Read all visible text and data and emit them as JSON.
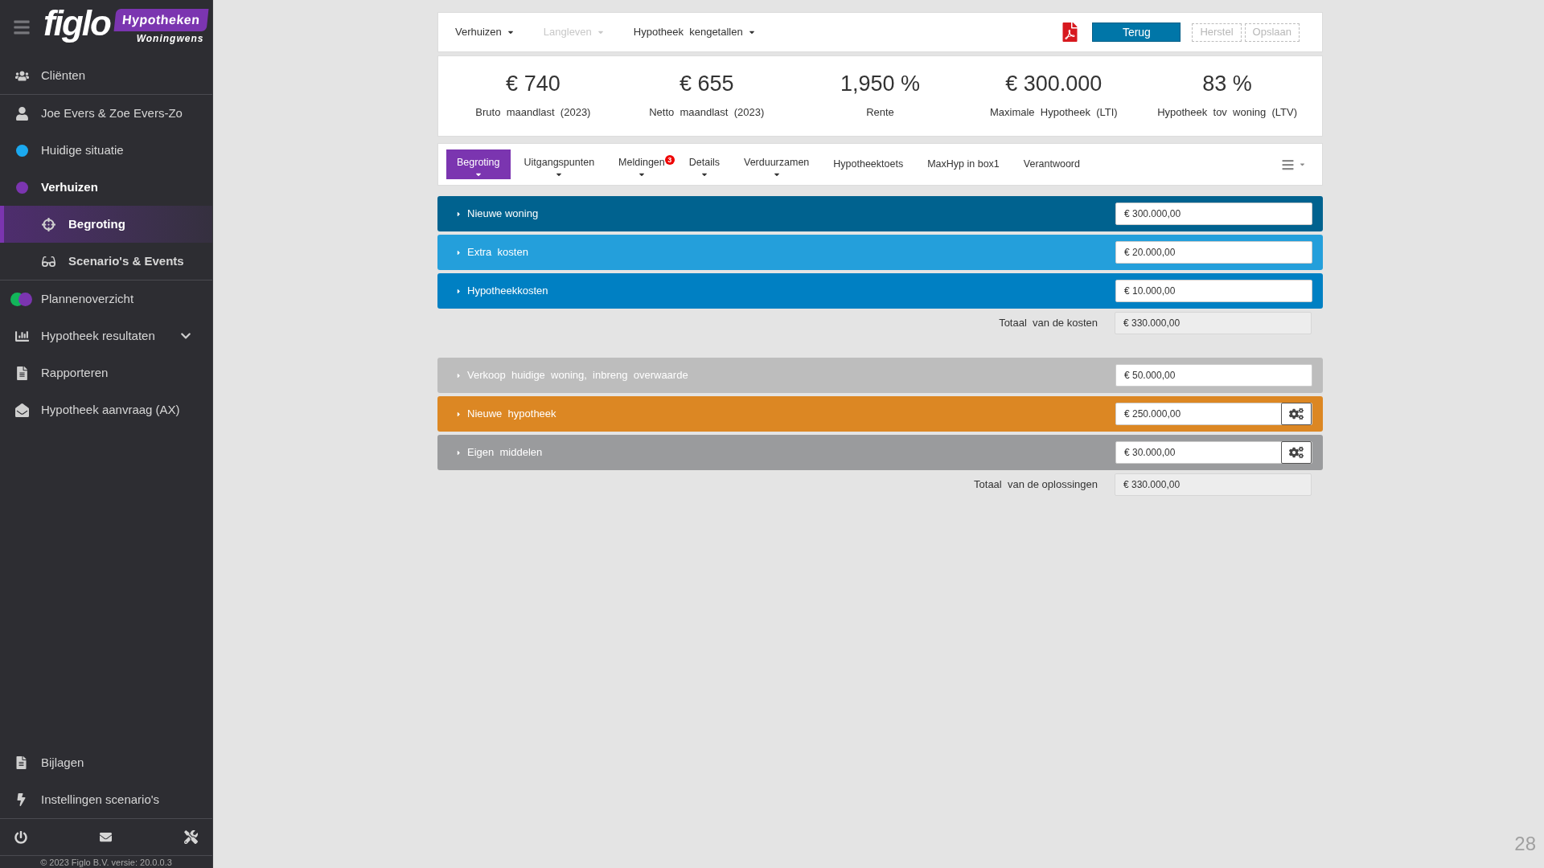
{
  "sidebar": {
    "logo": {
      "brand": "figlo",
      "badge": "Hypotheken",
      "subtitle": "Woningwens"
    },
    "sections": [
      {
        "items": [
          {
            "label": "Cliënten",
            "kind": "icon",
            "selected": false
          }
        ]
      },
      {
        "items": [
          {
            "label": "Joe Evers & Zoe Evers-Zo",
            "kind": "icon",
            "selected": false
          },
          {
            "label": "Huidige situatie",
            "kind": "dot",
            "color": "#1ba9f0",
            "selected": false
          },
          {
            "label": "Verhuizen",
            "kind": "dot",
            "color": "#7b35b0",
            "selected": false,
            "expanded": true,
            "children": [
              {
                "label": "Begroting",
                "selected": true
              },
              {
                "label": "Scenario's & Events",
                "selected": false
              }
            ]
          }
        ]
      },
      {
        "items": [
          {
            "label": "Plannenoverzicht",
            "kind": "dual-dot",
            "selected": false
          },
          {
            "label": "Hypotheek resultaten",
            "kind": "icon",
            "selected": false,
            "expanded": false
          },
          {
            "label": "Rapporteren",
            "kind": "icon",
            "selected": false
          },
          {
            "label": "Hypotheek aanvraag (AX)",
            "kind": "icon",
            "selected": false
          }
        ]
      }
    ],
    "bottom_items": [
      {
        "label": "Bijlagen"
      },
      {
        "label": "Instellingen scenario's"
      }
    ],
    "copyright": "© 2023 Figlo B.V. versie: 20.0.0.3"
  },
  "toolbar": {
    "menus": [
      {
        "label": "Verhuizen",
        "disabled": false
      },
      {
        "label": "Langleven",
        "disabled": true
      },
      {
        "label": "Hypotheek  kengetallen",
        "disabled": false
      }
    ],
    "buttons": [
      {
        "label": "Terug",
        "kind": "primary"
      },
      {
        "label": "Herstel",
        "kind": "dashed"
      },
      {
        "label": "Opslaan",
        "kind": "dashed"
      }
    ]
  },
  "kpis": [
    {
      "value": "€ 740",
      "label": "Bruto  maandlast  (2023)"
    },
    {
      "value": "€ 655",
      "label": "Netto  maandlast  (2023)"
    },
    {
      "value": "1,950 %",
      "label": "Rente"
    },
    {
      "value": "€ 300.000",
      "label": "Maximale  Hypotheek  (LTI)"
    },
    {
      "value": "83 %",
      "label": "Hypotheek  tov  woning  (LTV)"
    }
  ],
  "tabs": [
    {
      "label": "Begroting",
      "selected": true,
      "dropdown": true
    },
    {
      "label": "Uitgangspunten",
      "selected": false,
      "dropdown": true
    },
    {
      "label": "Meldingen",
      "selected": false,
      "dropdown": true,
      "badge": "3"
    },
    {
      "label": "Details",
      "selected": false,
      "dropdown": true
    },
    {
      "label": "Verduurzamen",
      "selected": false,
      "dropdown": true
    },
    {
      "label": "Hypotheektoets",
      "selected": false,
      "dropdown": false
    },
    {
      "label": "MaxHyp in box1",
      "selected": false,
      "dropdown": false
    },
    {
      "label": "Verantwoord",
      "selected": false,
      "dropdown": false
    }
  ],
  "costs": {
    "rows": [
      {
        "label": "Nieuwe woning",
        "value": "€ 300.000,00",
        "color": "#00628f",
        "settings": false
      },
      {
        "label": "Extra  kosten",
        "value": "€ 20.000,00",
        "color": "#249fdb",
        "settings": false
      },
      {
        "label": "Hypotheekkosten",
        "value": "€ 10.000,00",
        "color": "#0080c3",
        "settings": false
      }
    ],
    "total": {
      "label": "Totaal  van de kosten",
      "value": "€ 330.000,00"
    }
  },
  "solutions": {
    "rows": [
      {
        "label": "Verkoop  huidige  woning,  inbreng  overwaarde",
        "value": "€ 50.000,00",
        "color": "#bdbdbd",
        "settings": false
      },
      {
        "label": "Nieuwe  hypotheek",
        "value": "€ 250.000,00",
        "color": "#dc8723",
        "settings": true
      },
      {
        "label": "Eigen  middelen",
        "value": "€ 30.000,00",
        "color": "#9a9b9d",
        "settings": true
      }
    ],
    "total": {
      "label": "Totaal  van de oplossingen",
      "value": "€ 330.000,00"
    }
  },
  "page_number": "28"
}
